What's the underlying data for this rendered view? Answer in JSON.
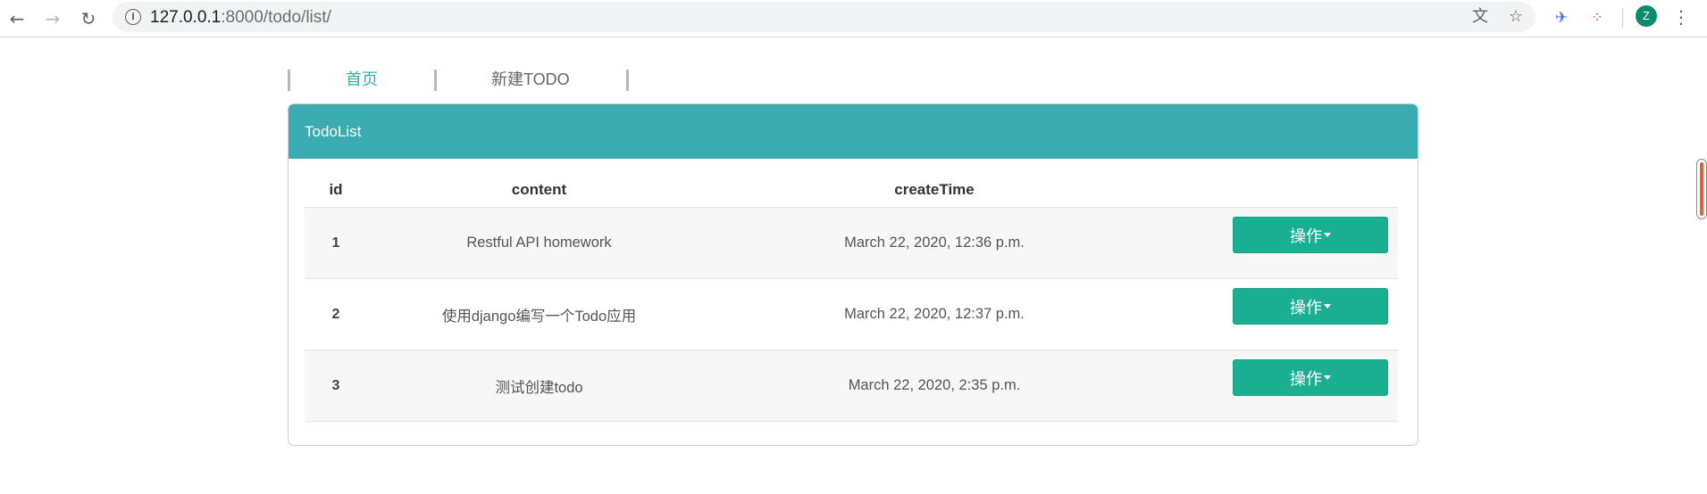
{
  "browser": {
    "url_host": "127.0.0.1",
    "url_rest": ":8000/todo/list/",
    "avatar_initial": "Z",
    "icons": {
      "back": "arrow-left-icon",
      "forward": "arrow-right-icon",
      "reload": "reload-icon",
      "info": "info-icon",
      "translate": "translate-icon",
      "bookmark": "star-icon",
      "extension1": "bird-extension-icon",
      "extension2": "network-extension-icon",
      "menu": "kebab-menu-icon"
    }
  },
  "nav": {
    "items": [
      {
        "label": "首页",
        "active": true
      },
      {
        "label": "新建TODO",
        "active": false
      }
    ]
  },
  "panel": {
    "title": "TodoList",
    "header_color": "#3aacb1",
    "columns": [
      "id",
      "content",
      "createTime",
      ""
    ],
    "rows": [
      {
        "id": "1",
        "content": "Restful API homework",
        "createTime": "March 22, 2020, 12:36 p.m.",
        "action": "操作"
      },
      {
        "id": "2",
        "content": "使用django编写一个Todo应用",
        "createTime": "March 22, 2020, 12:37 p.m.",
        "action": "操作"
      },
      {
        "id": "3",
        "content": "测试创建todo",
        "createTime": "March 22, 2020, 2:35 p.m.",
        "action": "操作"
      }
    ],
    "button_color": "#1aaf91"
  }
}
